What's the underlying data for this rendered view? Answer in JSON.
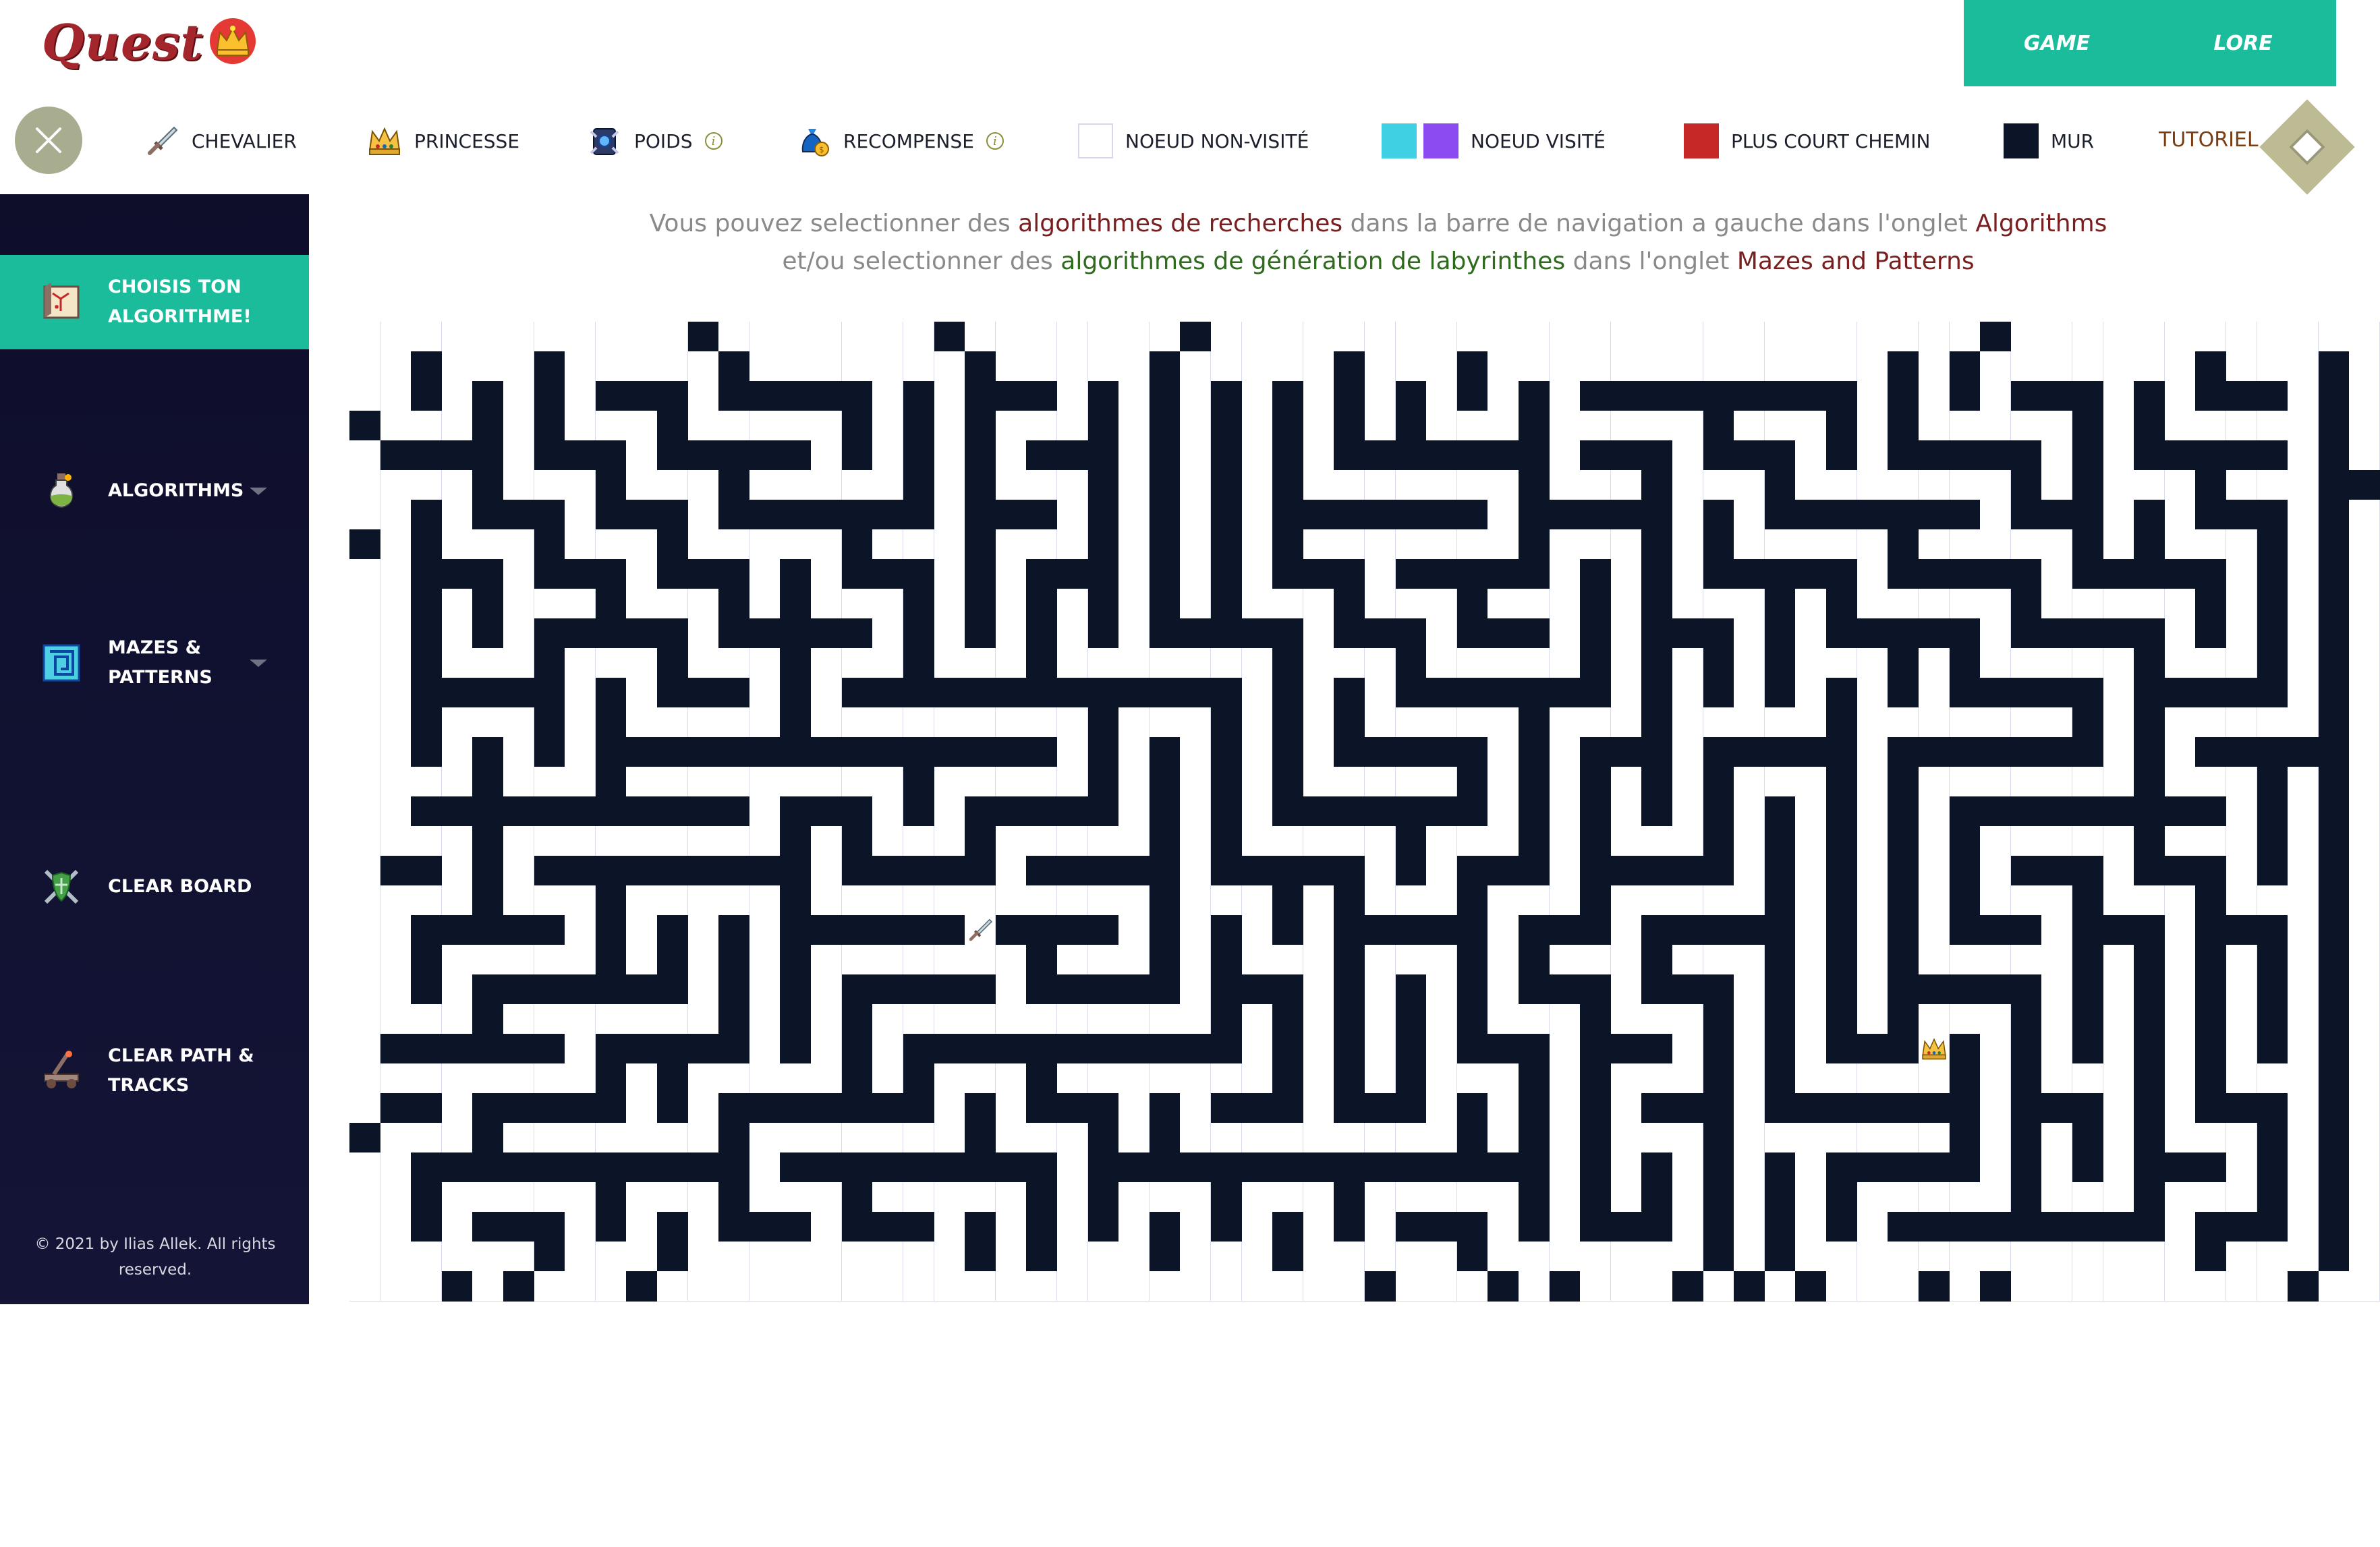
{
  "app": {
    "logo_text": "Quest"
  },
  "top_nav": {
    "items": [
      {
        "label": "GAME"
      },
      {
        "label": "LORE"
      }
    ]
  },
  "legend": {
    "close_icon": "close-x-icon",
    "items": [
      {
        "label": "CHEVALIER",
        "icon": "knight-sword-icon"
      },
      {
        "label": "PRINCESSE",
        "icon": "crown-icon"
      },
      {
        "label": "POIDS",
        "icon": "weight-shield-icon",
        "info": true
      },
      {
        "label": "RECOMPENSE",
        "icon": "money-bag-icon",
        "info": true
      },
      {
        "label": "NOEUD NON-VISITÉ",
        "swatches": [
          "#ffffff"
        ]
      },
      {
        "label": "NOEUD VISITÉ",
        "swatches": [
          "#3fd0e4",
          "#8c4bf0"
        ]
      },
      {
        "label": "PLUS COURT CHEMIN",
        "swatches": [
          "#c62828"
        ]
      },
      {
        "label": "MUR",
        "swatches": [
          "#0c1527"
        ]
      }
    ],
    "tutorial_label": "TUTORIEL"
  },
  "sidebar": {
    "items": [
      {
        "label_line1": "CHOISIS TON",
        "label_line2": "ALGORITHME!",
        "icon": "map-scroll-icon",
        "active": true
      },
      {
        "label_line1": "ALGORITHMS",
        "label_line2": "",
        "icon": "potion-icon",
        "dropdown": true
      },
      {
        "label_line1": "MAZES &",
        "label_line2": "PATTERNS",
        "icon": "maze-icon",
        "dropdown": true
      },
      {
        "label_line1": "CLEAR BOARD",
        "label_line2": "",
        "icon": "crossed-swords-shield-icon"
      },
      {
        "label_line1": "CLEAR PATH &",
        "label_line2": "TRACKS",
        "icon": "catapult-icon"
      }
    ],
    "copyright_line1": "© 2021 by Ilias Allek. All rights",
    "copyright_line2": "reserved."
  },
  "info_text": {
    "line1": [
      {
        "text": "Vous pouvez selectionner des ",
        "style": "plain"
      },
      {
        "text": "algorithmes de recherches",
        "style": "red"
      },
      {
        "text": " dans la barre de navigation a gauche dans l'onglet ",
        "style": "plain"
      },
      {
        "text": "Algorithms",
        "style": "red"
      }
    ],
    "line2": [
      {
        "text": "et/ou selectionner des ",
        "style": "plain"
      },
      {
        "text": "algorithmes de génération de labyrinthes",
        "style": "green"
      },
      {
        "text": " dans l'onglet ",
        "style": "plain"
      },
      {
        "text": "Mazes and Patterns",
        "style": "red"
      }
    ]
  },
  "grid": {
    "rows": 33,
    "cols": 66,
    "knight": {
      "row": 20,
      "col": 20,
      "icon": "knight-sword-icon"
    },
    "princess": {
      "row": 24,
      "col": 51,
      "icon": "crown-icon"
    },
    "colors": {
      "wall": "#0c1527",
      "empty": "#ffffff",
      "grid_line": "#d9dcef"
    }
  }
}
